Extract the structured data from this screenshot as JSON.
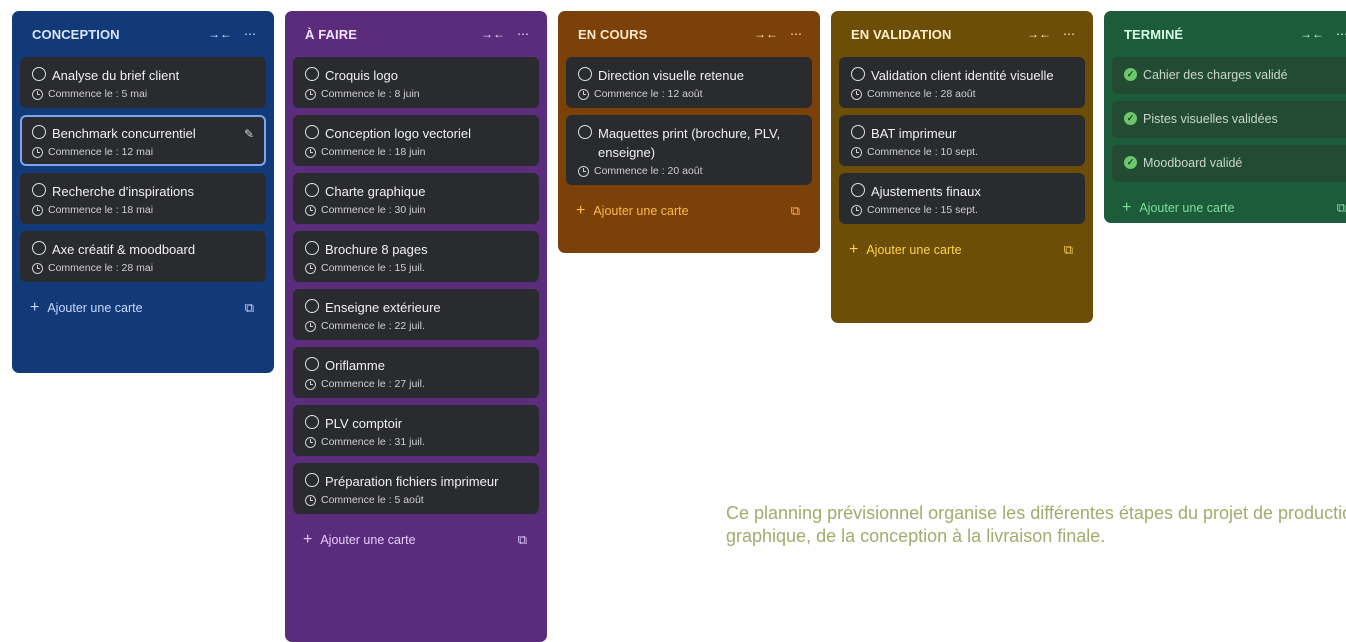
{
  "columns": [
    {
      "title": "CONCEPTION",
      "color": "#133a78",
      "cards": [
        {
          "title": "Analyse du brief client",
          "date": "Commence le : 5 mai"
        },
        {
          "title": "Benchmark concurrentiel",
          "date": "Commence le : 12 mai"
        },
        {
          "title": "Recherche d'inspirations",
          "date": "Commence le : 18 mai"
        },
        {
          "title": "Axe créatif & moodboard",
          "date": "Commence le : 28 mai"
        }
      ],
      "add_label": "Ajouter une carte"
    },
    {
      "title": "À FAIRE",
      "color": "#5b2c7c",
      "cards": [
        {
          "title": "Croquis logo",
          "date": "Commence le : 8 juin"
        },
        {
          "title": "Conception logo vectoriel",
          "date": "Commence le : 18 juin"
        },
        {
          "title": "Charte graphique",
          "date": "Commence le : 30 juin"
        },
        {
          "title": "Brochure 8 pages",
          "date": "Commence le : 15 juil."
        },
        {
          "title": "Enseigne extérieure",
          "date": "Commence le : 22 juil."
        },
        {
          "title": "Oriflamme",
          "date": "Commence le : 27 juil."
        },
        {
          "title": "PLV comptoir",
          "date": "Commence le : 31 juil."
        },
        {
          "title": "Préparation fichiers imprimeur",
          "date": "Commence le : 5 août"
        }
      ],
      "add_label": "Ajouter une carte"
    },
    {
      "title": "EN COURS",
      "color": "#7b4108",
      "cards": [
        {
          "title": "Direction visuelle retenue",
          "date": "Commence le : 12 août"
        },
        {
          "title": "Maquettes print (brochure, PLV, enseigne)",
          "date": "Commence le : 20 août"
        }
      ],
      "add_label": "Ajouter une carte"
    },
    {
      "title": "EN VALIDATION",
      "color": "#6d4e09",
      "cards": [
        {
          "title": "Validation client identité visuelle",
          "date": "Commence le : 28 août"
        },
        {
          "title": "BAT imprimeur",
          "date": "Commence le : 10 sept."
        },
        {
          "title": "Ajustements finaux",
          "date": "Commence le : 15 sept."
        }
      ],
      "add_label": "Ajouter une carte"
    },
    {
      "title": "TERMINÉ",
      "color": "#1c5c3a",
      "cards": [
        {
          "title": "Cahier des charges validé"
        },
        {
          "title": "Pistes visuelles validées"
        },
        {
          "title": "Moodboard validé"
        }
      ],
      "add_label": "Ajouter une carte"
    }
  ],
  "icons": {
    "collapse": "collapse-icon",
    "more": "more-icon",
    "clock": "clock-icon",
    "edit": "edit-icon",
    "add": "plus-icon",
    "template": "card-template-icon",
    "check": "check-circle-icon"
  },
  "note": "Ce planning prévisionnel organise les différentes étapes du projet de production graphique, de la conception à la livraison finale."
}
